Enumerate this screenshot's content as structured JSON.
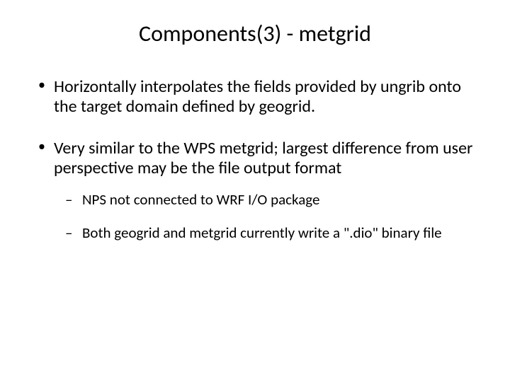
{
  "title": "Components(3) - metgrid",
  "bullets": [
    {
      "text": "Horizontally interpolates the fields provided by ungrib onto the target domain defined by geogrid."
    },
    {
      "text": "Very similar to the WPS metgrid; largest difference from user perspective may be the file output format",
      "sub": [
        {
          "text": "NPS not connected to WRF I/O package"
        },
        {
          "text": "Both geogrid and metgrid currently write a \".dio\" binary file"
        }
      ]
    }
  ]
}
